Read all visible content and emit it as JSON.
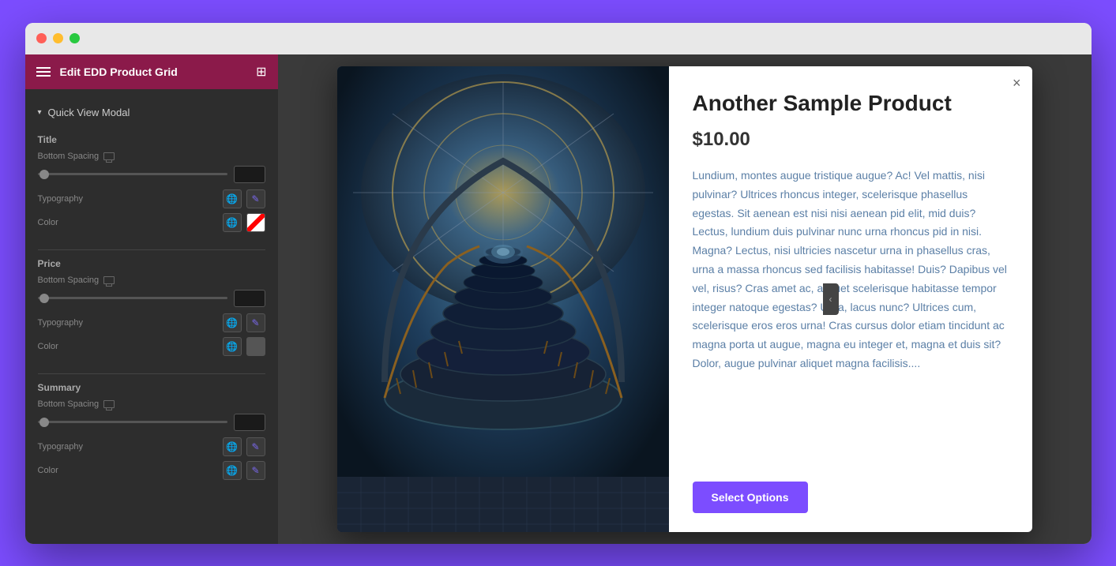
{
  "window": {
    "title": "Edit EDD Product Grid"
  },
  "sidebar": {
    "header": {
      "title": "Edit EDD Product Grid"
    },
    "quick_view_modal": {
      "label": "Quick View Modal"
    },
    "sections": [
      {
        "id": "title",
        "label": "Title",
        "settings": [
          {
            "type": "spacing",
            "label": "Bottom Spacing",
            "value": ""
          },
          {
            "type": "typography",
            "label": "Typography"
          },
          {
            "type": "color",
            "label": "Color",
            "swatch": "transparent"
          }
        ]
      },
      {
        "id": "price",
        "label": "Price",
        "settings": [
          {
            "type": "spacing",
            "label": "Bottom Spacing",
            "value": ""
          },
          {
            "type": "typography",
            "label": "Typography"
          },
          {
            "type": "color",
            "label": "Color",
            "swatch": "dark"
          }
        ]
      },
      {
        "id": "summary",
        "label": "Summary",
        "settings": [
          {
            "type": "spacing",
            "label": "Bottom Spacing",
            "value": ""
          },
          {
            "type": "typography",
            "label": "Typography"
          },
          {
            "type": "color",
            "label": "Color"
          }
        ]
      }
    ]
  },
  "modal": {
    "product_title": "Another Sample Product",
    "product_price": "$10.00",
    "product_description": "Lundium, montes augue tristique augue? Ac! Vel mattis, nisi pulvinar? Ultrices rhoncus integer, scelerisque phasellus egestas. Sit aenean est nisi nisi aenean pid elit, mid duis? Lectus, lundium duis pulvinar nunc urna rhoncus pid in nisi. Magna? Lectus, nisi ultricies nascetur urna in phasellus cras, urna a massa rhoncus sed facilisis habitasse! Duis? Dapibus vel vel, risus? Cras amet ac, aliquet scelerisque habitasse tempor integer natoque egestas? Urna, lacus nunc? Ultrices cum, scelerisque eros eros urna! Cras cursus dolor etiam tincidunt ac magna porta ut augue, magna eu integer et, magna et duis sit? Dolor, augue pulvinar aliquet magna facilisis....",
    "select_button_label": "Select Options",
    "close_label": "×"
  },
  "colors": {
    "sidebar_header_bg": "#8b1a4a",
    "sidebar_bg": "#2d2d2d",
    "accent_purple": "#7c4dff",
    "accent_blue": "#7b68ee",
    "text_blue": "#5b7fa6"
  },
  "icons": {
    "hamburger": "☰",
    "grid": "⊞",
    "arrow_down": "▾",
    "globe": "🌐",
    "edit": "✎",
    "monitor": "▭",
    "chevron_left": "‹"
  }
}
